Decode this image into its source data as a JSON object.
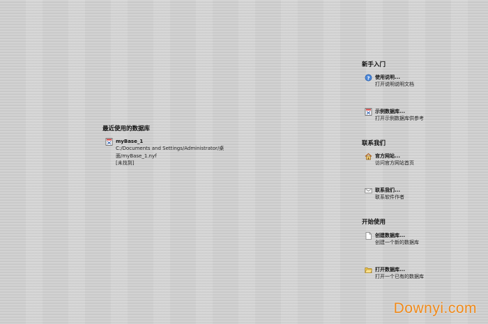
{
  "recent": {
    "title": "最近使用的数据库",
    "items": [
      {
        "icon": "database-file-icon",
        "name": "myBase_1",
        "path_line1": "C:/Documents and Settings/Administrator/桌",
        "path_line2": "面/myBase_1.nyf",
        "status": "[未找到]"
      }
    ]
  },
  "getting_started": {
    "title": "新手入门",
    "items": [
      {
        "icon": "help-icon",
        "label": "使用说明...",
        "desc": "打开说明说明文档"
      },
      {
        "icon": "sample-database-icon",
        "label": "示例数据库...",
        "desc": "打开示例数据库供参考"
      }
    ]
  },
  "contact": {
    "title": "联系我们",
    "items": [
      {
        "icon": "home-icon",
        "label": "官方网站...",
        "desc": "访问官方网站首页"
      },
      {
        "icon": "mail-icon",
        "label": "联系我们...",
        "desc": "联系软件作者"
      }
    ]
  },
  "start": {
    "title": "开始使用",
    "items": [
      {
        "icon": "new-document-icon",
        "label": "创建数据库...",
        "desc": "创建一个新的数据库"
      },
      {
        "icon": "open-folder-icon",
        "label": "打开数据库...",
        "desc": "打开一个已有的数据库"
      }
    ]
  },
  "watermark": "Downyi.com"
}
